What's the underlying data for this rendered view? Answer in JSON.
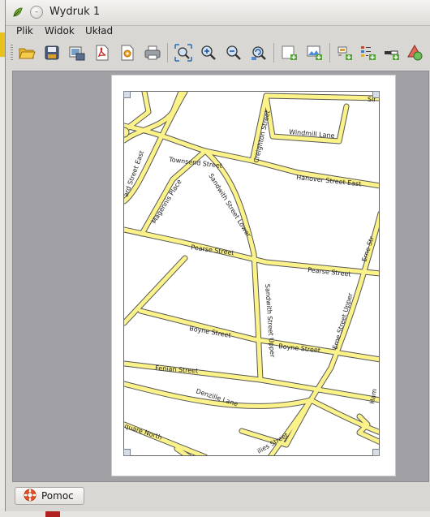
{
  "window": {
    "title": "Wydruk 1"
  },
  "menubar": {
    "items": [
      "Plik",
      "Widok",
      "Układ"
    ]
  },
  "toolbar": {
    "buttons": [
      "open-template-icon",
      "save-template-icon",
      "export-image-icon",
      "export-pdf-icon",
      "export-svg-icon",
      "print-icon",
      "zoom-full-icon",
      "zoom-in-icon",
      "zoom-out-icon",
      "refresh-icon",
      "add-map-icon",
      "add-image-icon",
      "add-label-icon",
      "add-legend-icon",
      "add-scalebar-icon",
      "add-shape-icon"
    ]
  },
  "map": {
    "streets": {
      "townsend": "Townsend Street",
      "hanover": "Hanover Street East",
      "windmill": "Windmill Lane",
      "creighton": "Creighton Street",
      "sir": "Sir",
      "gard": "ard Street East",
      "magennis": "Magennis Place",
      "sandwith_lower": "Sandwith Street Lower",
      "pearse_left": "Pearse Street",
      "pearse_right": "Pearse Street",
      "erne": "Erne Str",
      "sandwith_upper": "Sandwith Street Upper",
      "boyne_left": "Boyne Street",
      "boyne_right": "Boyne Street",
      "erne_upper": "Erne Street Upper",
      "fenian": "Fenian Street",
      "denzille": "Denzille Lane",
      "ham": "Ham",
      "square_north": "quare North",
      "ilies": "ilies Street"
    }
  },
  "bottom": {
    "help_label": "Pomoc"
  }
}
